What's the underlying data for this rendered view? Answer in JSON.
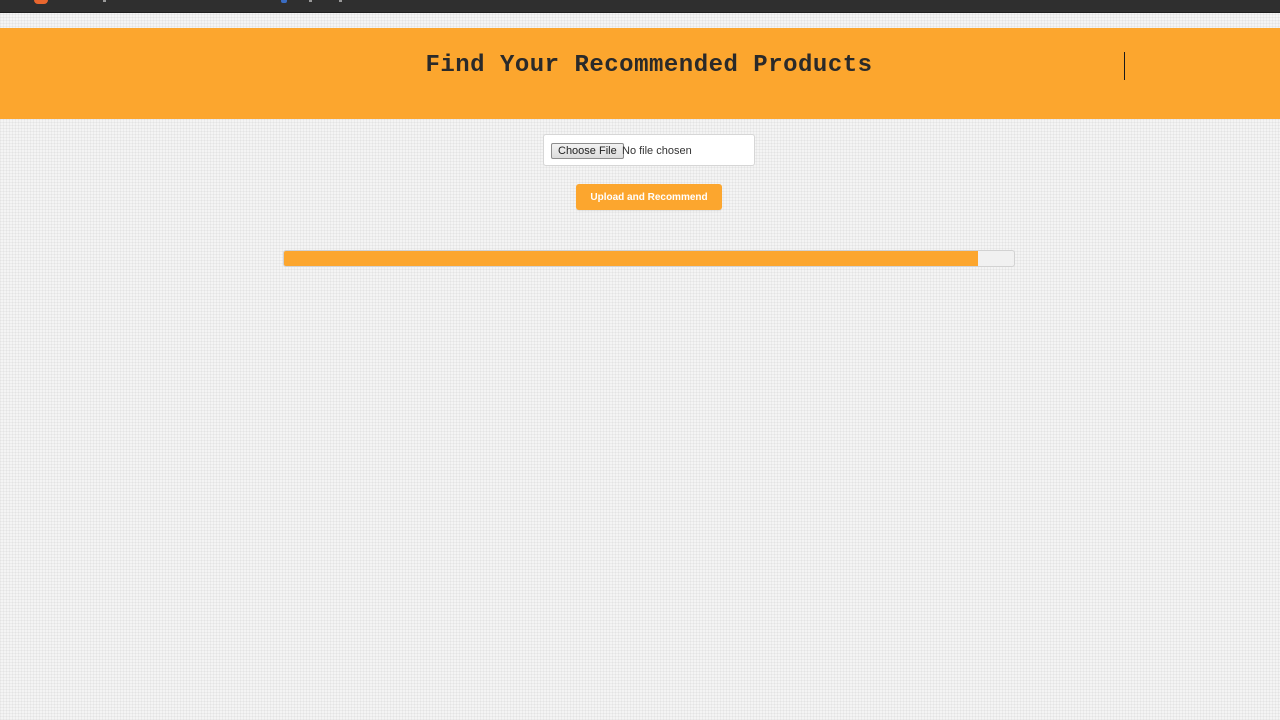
{
  "header": {
    "title": "Find Your Recommended Products",
    "background_color": "#fca62e"
  },
  "upload_form": {
    "choose_file_label": "Choose File",
    "file_status": "No file chosen",
    "submit_label": "Upload and Recommend"
  },
  "progress": {
    "fraction": 0.95,
    "color": "#fca62e"
  },
  "icons": {
    "top_strip": [
      "app-icon",
      "tab-icon"
    ]
  }
}
